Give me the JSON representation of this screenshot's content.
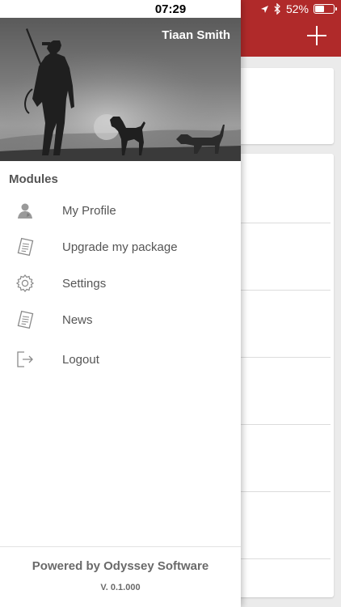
{
  "status_bar": {
    "time": "07:29",
    "battery_text": "52%",
    "battery_level": 0.52
  },
  "drawer": {
    "user_name": "Tiaan Smith",
    "section_title": "Modules",
    "items": [
      {
        "label": "My Profile",
        "icon": "profile-icon"
      },
      {
        "label": "Upgrade my package",
        "icon": "document-icon"
      },
      {
        "label": "Settings",
        "icon": "gear-icon"
      },
      {
        "label": "News",
        "icon": "document-icon"
      },
      {
        "label": "Logout",
        "icon": "logout-icon"
      }
    ],
    "footer": {
      "powered_by": "Powered by Odyssey Software",
      "version": "V. 0.1.000"
    }
  },
  "colors": {
    "brand": "#b02a2a",
    "text": "#555555"
  }
}
